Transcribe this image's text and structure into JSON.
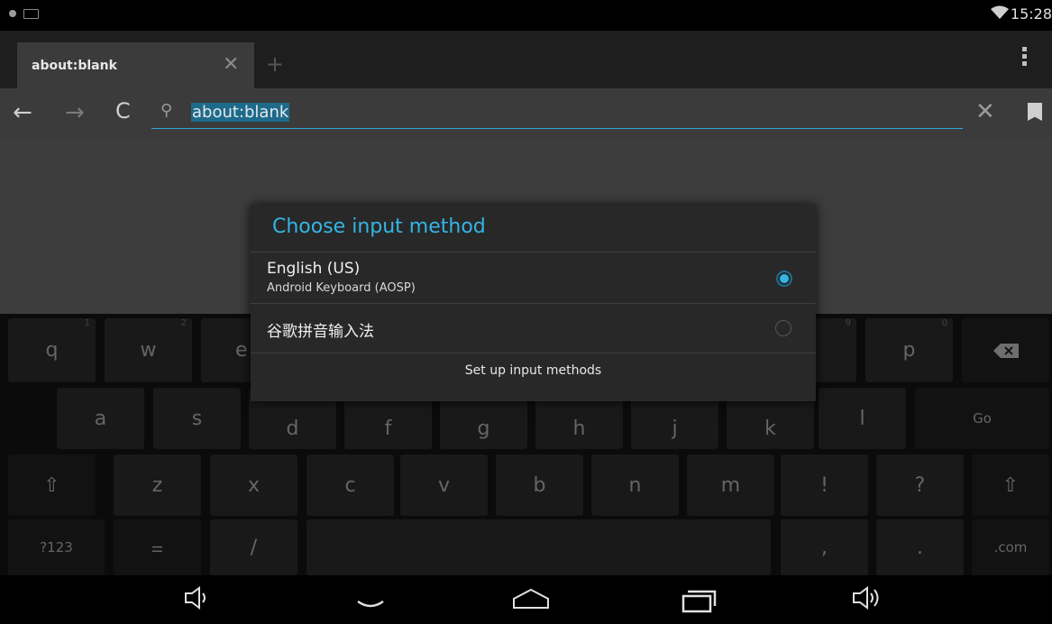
{
  "status_bar": {
    "time": "15:28",
    "icons": [
      "notification-dot-icon",
      "keyboard-icon",
      "wifi-icon"
    ]
  },
  "browser": {
    "tab_title": "about:blank",
    "url": "about:blank",
    "icons": [
      "back-icon",
      "forward-icon",
      "reload-icon",
      "search-icon",
      "clear-icon",
      "bookmark-icon",
      "overflow-menu-icon",
      "new-tab-icon"
    ]
  },
  "dialog": {
    "title": "Choose input method",
    "options": [
      {
        "title": "English (US)",
        "subtitle": "Android Keyboard (AOSP)",
        "selected": true
      },
      {
        "title": "谷歌拼音输入法",
        "subtitle": "",
        "selected": false
      }
    ],
    "footer": "Set up input methods"
  },
  "keyboard": {
    "row1": [
      {
        "label": "q",
        "hint": "1"
      },
      {
        "label": "w",
        "hint": "2"
      },
      {
        "label": "e",
        "hint": ""
      },
      {
        "label": "p",
        "hint": "0"
      }
    ],
    "row1_hint_9": "9",
    "row2": [
      "a",
      "s",
      "d",
      "f",
      "g",
      "h",
      "j",
      "k",
      "l"
    ],
    "row3": [
      "z",
      "x",
      "c",
      "v",
      "b",
      "n",
      "m",
      "!",
      "?"
    ],
    "go_label": "Go",
    "symbols_label": "?123",
    "slash_label": "/",
    "comma_label": ",",
    "period_label": ".",
    "com_label": ".com",
    "colors": {
      "accent": "#33b5e5"
    }
  },
  "nav_icons": [
    "volume-down-icon",
    "hide-keyboard-icon",
    "home-icon",
    "recents-icon",
    "volume-up-icon"
  ]
}
